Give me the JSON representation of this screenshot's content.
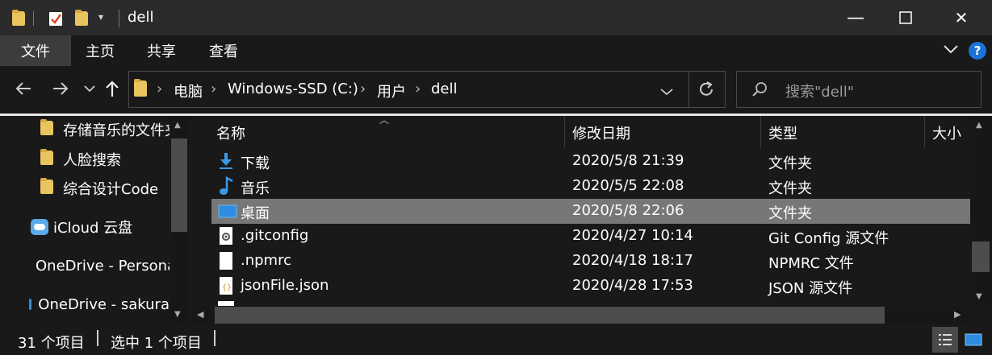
{
  "title": "dell",
  "window_controls": {
    "minimize": "—",
    "maximize": "☐",
    "close": "✕"
  },
  "ribbon": {
    "tabs": [
      "文件",
      "主页",
      "共享",
      "查看"
    ],
    "help": "?"
  },
  "address": {
    "crumbs": [
      "电脑",
      "Windows-SSD (C:)",
      "用户",
      "dell"
    ],
    "search_placeholder": "搜索\"dell\""
  },
  "nav": {
    "items": [
      {
        "label": "存储音乐的文件夹",
        "icon": "folder-icon"
      },
      {
        "label": "人脸搜索",
        "icon": "folder-icon"
      },
      {
        "label": "综合设计Code",
        "icon": "folder-icon"
      },
      {
        "label": "iCloud 云盘",
        "icon": "icloud-icon"
      },
      {
        "label": "OneDrive - Personal",
        "icon": "onedrive-icon"
      },
      {
        "label": "OneDrive - sakura",
        "icon": "onedrive-icon"
      }
    ]
  },
  "columns": {
    "name": "名称",
    "modified": "修改日期",
    "type": "类型",
    "size": "大小"
  },
  "files": [
    {
      "name": "下载",
      "modified": "2020/5/8 21:39",
      "type": "文件夹",
      "icon": "download-icon"
    },
    {
      "name": "音乐",
      "modified": "2020/5/5 22:08",
      "type": "文件夹",
      "icon": "music-icon"
    },
    {
      "name": "桌面",
      "modified": "2020/5/8 22:06",
      "type": "文件夹",
      "icon": "desktop-icon",
      "selected": true
    },
    {
      "name": ".gitconfig",
      "modified": "2020/4/27 10:14",
      "type": "Git Config 源文件",
      "icon": "config-file-icon"
    },
    {
      "name": ".npmrc",
      "modified": "2020/4/18 18:17",
      "type": "NPMRC 文件",
      "icon": "file-icon"
    },
    {
      "name": "jsonFile.json",
      "modified": "2020/4/28 17:53",
      "type": "JSON 源文件",
      "icon": "json-file-icon"
    }
  ],
  "status": {
    "count": "31 个项目",
    "selected": "选中 1 个项目"
  },
  "colors": {
    "selection": "#777777",
    "background": "#191919",
    "accent": "#0078d7"
  }
}
